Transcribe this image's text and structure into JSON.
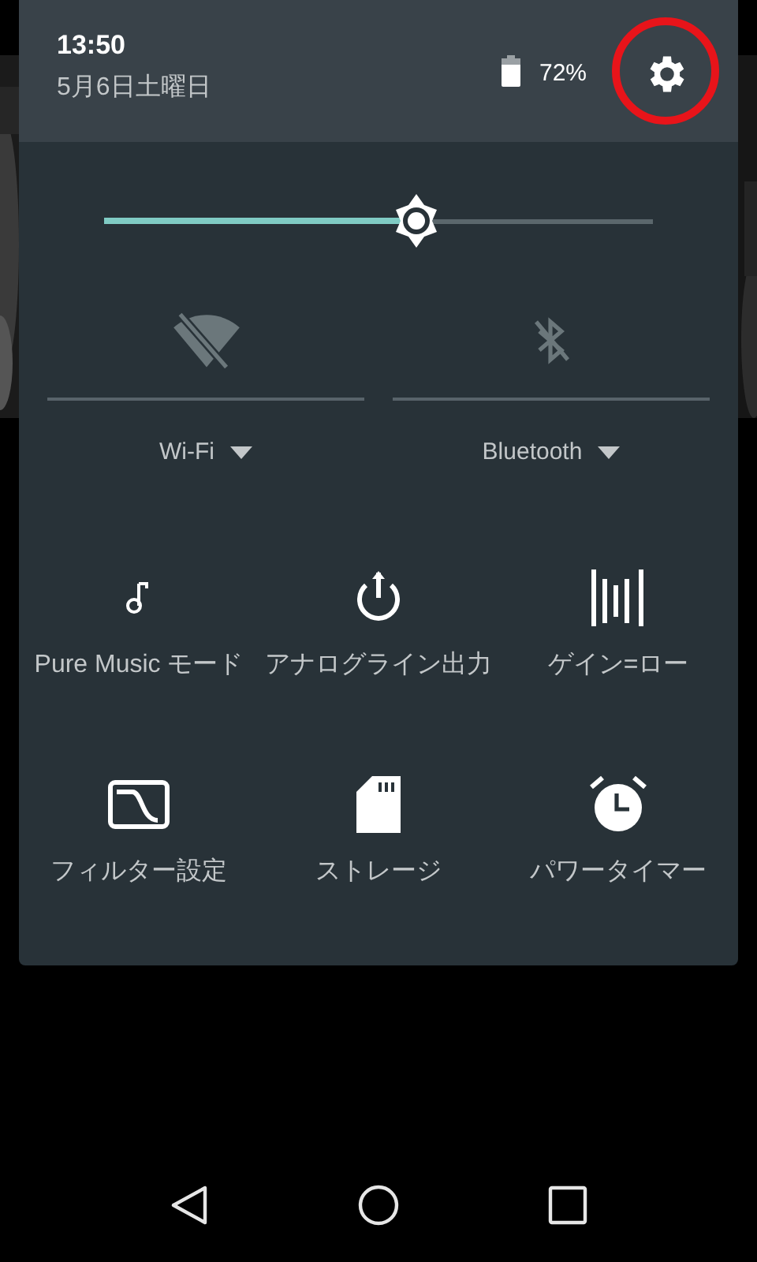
{
  "header": {
    "time": "13:50",
    "date": "5月6日土曜日",
    "battery": "72%"
  },
  "brightness": {
    "level": 0.57
  },
  "toggles": [
    {
      "label": "Wi-Fi",
      "on": false
    },
    {
      "label": "Bluetooth",
      "on": false
    }
  ],
  "tiles": [
    {
      "label": "Pure Music モード"
    },
    {
      "label": "アナログライン出力"
    },
    {
      "label": "ゲイン=ロー"
    },
    {
      "label": "フィルター設定"
    },
    {
      "label": "ストレージ"
    },
    {
      "label": "パワータイマー"
    }
  ]
}
